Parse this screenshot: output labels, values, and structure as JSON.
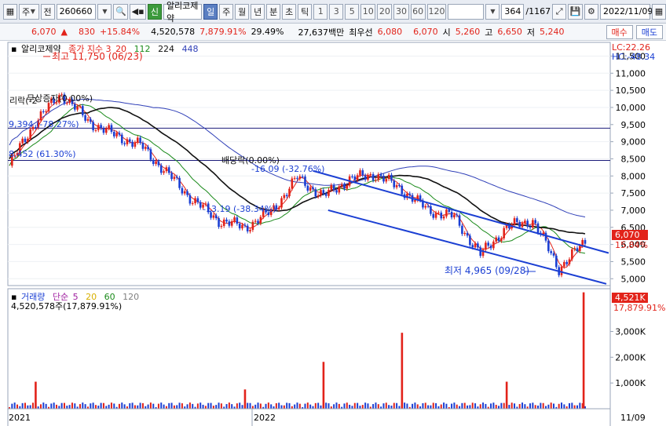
{
  "toolbar": {
    "type_label": "주",
    "market_label": "전",
    "stock_code": "260660",
    "new_badge": "신",
    "stock_name": "알리코제약",
    "periods": [
      "일",
      "주",
      "월",
      "년",
      "분",
      "초",
      "틱"
    ],
    "selected_period": "일",
    "numbers": [
      "1",
      "3",
      "5",
      "10",
      "20",
      "30",
      "60",
      "120"
    ],
    "count": "364",
    "total": "/1167",
    "date": "2022/11/09"
  },
  "info": {
    "price": "6,070",
    "change": "830",
    "change_pct": "+15.84%",
    "volume": "4,520,578",
    "volume_ratio": "7,879.91%",
    "turnover_pct": "29.49%",
    "amount": "27,637백만",
    "best_sell_label": "최우선",
    "best_sell": "6,080",
    "best_buy": "6,070",
    "open_label": "시",
    "open": "5,260",
    "high_label": "고",
    "high": "6,650",
    "low_label": "저",
    "low": "5,240",
    "buy_label": "매수",
    "sell_label": "매도"
  },
  "colors": {
    "up": "#e2231a",
    "down": "#1b3fd3",
    "ma3": "#e2231a",
    "ma20": "#1b3fd3",
    "ma112": "#1a8a1a",
    "ma224": "#111111",
    "ma448": "#3040b8",
    "vol5": "#a020a0",
    "vol20": "#d8b000",
    "vol60": "#1a8a1a",
    "vol120": "#808080"
  },
  "price_panel": {
    "title": "알리코제약",
    "legend_label": "종가 지수 3",
    "ma": [
      "20",
      "112",
      "224",
      "448"
    ],
    "lc": "LC:22.26",
    "hc": "HC:-48.34",
    "high_note": "최고 11,750 (06/23)",
    "low_note": "최저 4,965 (09/28)",
    "ann_rights": "무상증자(0.00%)",
    "ann_rights_prefix": "리락(-2",
    "ann_pct1": "(-78.27%)",
    "ann_price1": "9,394",
    "ann_price2": "8,452 (61.30%)",
    "ann_dividend": "배당락(0.00%)",
    "ann_pct2": "-16.09 (-32.76%)",
    "ann_pct3": "-13.19 (-38.34%)",
    "current_price": "6,070",
    "current_pct": "15.84%",
    "y_ticks": [
      "11,500",
      "11,000",
      "10,500",
      "10,000",
      "9,500",
      "9,000",
      "8,500",
      "8,000",
      "7,500",
      "7,000",
      "6,500",
      "6,000",
      "5,500",
      "5,000"
    ]
  },
  "volume_panel": {
    "legend_label": "거래량",
    "legend_ma": "단순",
    "ma": [
      "5",
      "20",
      "60",
      "120"
    ],
    "value_line": "4,520,578주(17,879.91%)",
    "current_label": "4,521K",
    "current_pct": "17,879.91%",
    "y_ticks": [
      "3,000K",
      "2,000K",
      "1,000K"
    ]
  },
  "x_axis": {
    "labels": [
      "2021",
      "2022"
    ],
    "right_label": "11/09"
  },
  "chart_data": {
    "type": "line",
    "series": [
      {
        "name": "종가",
        "x": [
          "2021/01",
          "2021/02",
          "2021/03",
          "2021/04",
          "2021/05",
          "2021/06",
          "2021/07",
          "2021/08",
          "2021/09",
          "2021/10",
          "2021/11",
          "2021/12",
          "2022/01",
          "2022/02",
          "2022/03",
          "2022/04",
          "2022/05",
          "2022/06",
          "2022/07",
          "2022/08",
          "2022/09",
          "2022/10",
          "2022/11"
        ],
        "values": [
          8300,
          9600,
          10400,
          9600,
          9200,
          8900,
          8100,
          7300,
          6700,
          6500,
          6950,
          7950,
          7400,
          7900,
          8050,
          7600,
          7000,
          6800,
          5700,
          6500,
          6700,
          5300,
          6070
        ]
      }
    ],
    "ylim": [
      4800,
      11900
    ],
    "volume": {
      "spikes": [
        {
          "x": "2021/02",
          "value": 1050000
        },
        {
          "x": "2021/10",
          "value": 750000
        },
        {
          "x": "2022/01",
          "value": 1820000
        },
        {
          "x": "2022/04",
          "value": 2950000
        },
        {
          "x": "2022/08",
          "value": 1050000
        },
        {
          "x": "2022/11",
          "value": 4520578
        }
      ],
      "ylim": [
        0,
        4600000
      ]
    }
  }
}
